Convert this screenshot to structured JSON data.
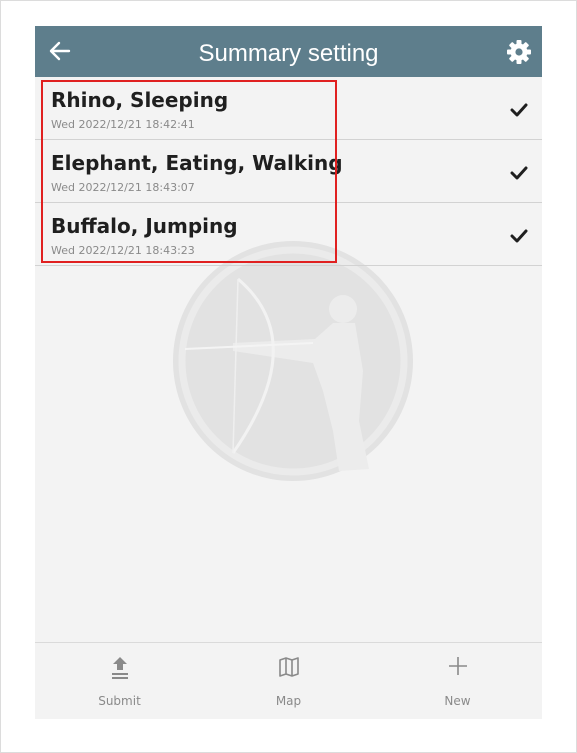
{
  "header": {
    "title": "Summary setting",
    "back_icon": "arrow-left-icon",
    "settings_icon": "gear-icon",
    "color": "#5e7e8c"
  },
  "list": {
    "items": [
      {
        "name": "Rhino, Sleeping",
        "date": "Wed 2022/12/21 18:42:41",
        "checked": true
      },
      {
        "name": "Elephant, Eating, Walking",
        "date": "Wed 2022/12/21 18:43:07",
        "checked": true
      },
      {
        "name": "Buffalo, Jumping",
        "date": "Wed 2022/12/21 18:43:23",
        "checked": true
      }
    ]
  },
  "toolbar": {
    "submit_label": "Submit",
    "map_label": "Map",
    "new_label": "New",
    "submit_icon": "upload-icon",
    "map_icon": "map-icon",
    "new_icon": "plus-icon"
  },
  "colors": {
    "highlight": "#e02020",
    "background": "#f3f3f3"
  }
}
